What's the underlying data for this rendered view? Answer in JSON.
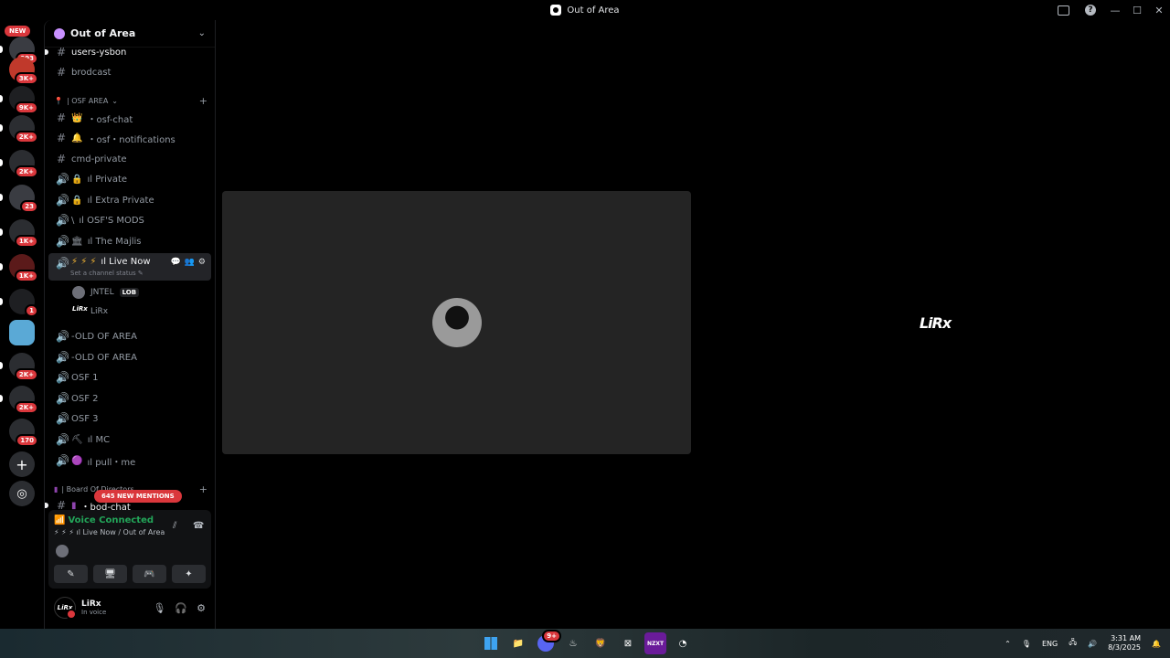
{
  "window": {
    "title": "Out of Area",
    "controls": [
      "—",
      "☐",
      "✕"
    ]
  },
  "rail": {
    "new_label": "NEW",
    "servers": [
      {
        "name": "server-1",
        "badge": "993",
        "color": "#3a3c42"
      },
      {
        "name": "server-2",
        "badge": "3K+",
        "color": "#c0392b"
      },
      {
        "name": "server-3",
        "badge": "9K+",
        "color": "#1e1f22"
      },
      {
        "name": "server-4",
        "badge": "2K+",
        "color": "#2b2d31"
      },
      {
        "name": "server-5",
        "badge": "2K+",
        "color": "#2b2d31"
      },
      {
        "name": "server-6",
        "badge": "23",
        "color": "#3a3c42"
      },
      {
        "name": "server-7",
        "badge": "1K+",
        "color": "#2b2d31"
      },
      {
        "name": "server-8",
        "badge": "1K+",
        "color": "#5b1a1a"
      },
      {
        "name": "server-9",
        "badge": "1",
        "color": "#1e1f22"
      },
      {
        "name": "server-10",
        "badge": "",
        "color": "#5aa9d6"
      },
      {
        "name": "server-11",
        "badge": "2K+",
        "color": "#2b2d31"
      },
      {
        "name": "server-12",
        "badge": "2K+",
        "color": "#2b2d31"
      },
      {
        "name": "server-13",
        "badge": "170",
        "color": "#2b2d31"
      }
    ],
    "add_server": "+",
    "discover": "◎"
  },
  "sidebar": {
    "server_name": "Out of Area",
    "channels_top": [
      {
        "type": "text",
        "name": "users-ysbon",
        "emoji": ""
      },
      {
        "type": "text",
        "name": "brodcast",
        "emoji": ""
      }
    ],
    "category_osf": "| OSF AREA",
    "channels_osf": [
      {
        "type": "text",
        "name": "・osf-chat",
        "emoji": "👑"
      },
      {
        "type": "text",
        "name": "・osf・notifications",
        "emoji": "🔔"
      },
      {
        "type": "text",
        "name": "cmd-private",
        "emoji": ""
      },
      {
        "type": "voice",
        "name": "ıl Private",
        "emoji": "🔒"
      },
      {
        "type": "voice",
        "name": "ıl Extra Private",
        "emoji": "🔒"
      },
      {
        "type": "voice",
        "name": "ıl OSF'S MODS",
        "emoji": "\\"
      },
      {
        "type": "voice",
        "name": "ıl The Majlis",
        "emoji": "🏛"
      }
    ],
    "active_channel": {
      "name": "ıl Live Now",
      "emoji": "⚡ ⚡ ⚡",
      "status": "Set a channel status ✎"
    },
    "voice_users": [
      {
        "name": "JNTEL",
        "tag": "LOB"
      },
      {
        "name": "LiRx",
        "tag": ""
      }
    ],
    "channels_after": [
      {
        "type": "voice",
        "name": "-OLD OF AREA",
        "emoji": ""
      },
      {
        "type": "voice",
        "name": "-OLD OF AREA",
        "emoji": ""
      },
      {
        "type": "voice",
        "name": "OSF 1",
        "emoji": ""
      },
      {
        "type": "voice",
        "name": "OSF 2",
        "emoji": ""
      },
      {
        "type": "voice",
        "name": "OSF 3",
        "emoji": ""
      },
      {
        "type": "voice",
        "name": "ıl MC",
        "emoji": "⛏"
      },
      {
        "type": "voice",
        "name": "ıl pull・me",
        "emoji": "🟣"
      }
    ],
    "category_board": "| Board Of Directors",
    "channel_board": "・bod-chat",
    "mentions_label": "645 NEW MENTIONS"
  },
  "voice_panel": {
    "status": "Voice Connected",
    "location": "⚡ ⚡ ⚡ ıl Live Now / Out of Area"
  },
  "user_panel": {
    "name": "LiRx",
    "status": "In voice",
    "avatar_text": "LiRx"
  },
  "stage": {
    "right_logo": "LiRx"
  },
  "taskbar": {
    "discord_badge": "9+",
    "tray_lang": "ENG",
    "time": "3:31 AM",
    "date": "8/3/2025"
  }
}
